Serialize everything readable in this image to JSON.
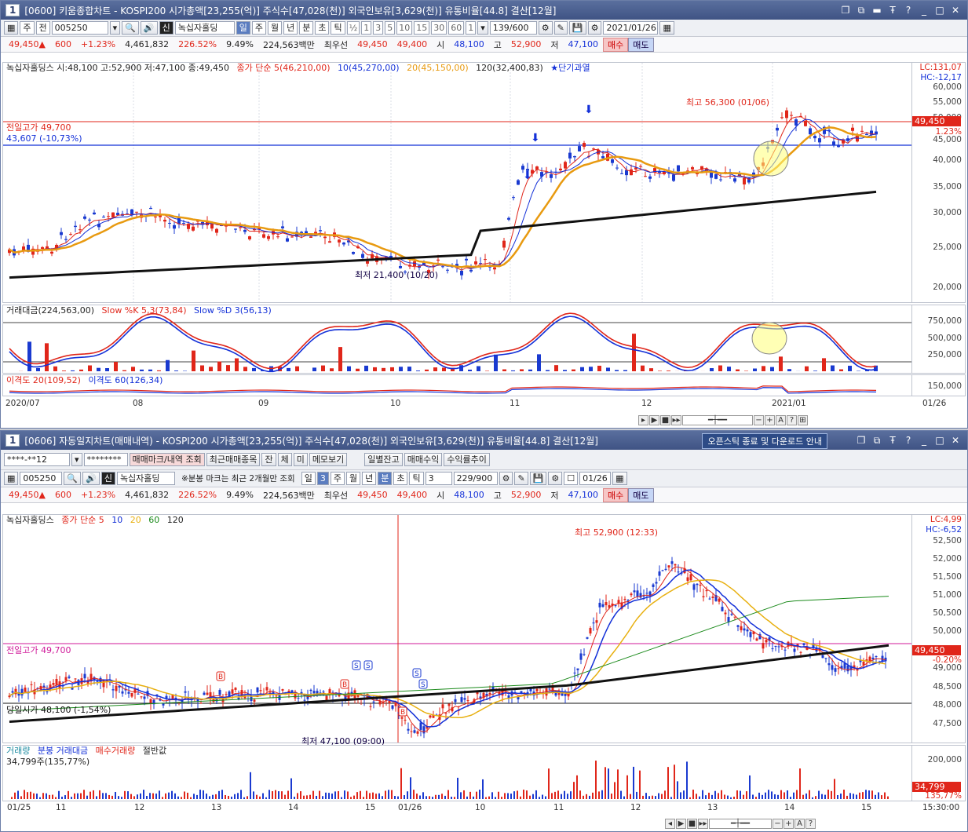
{
  "top": {
    "title": "[0600] 키움종합차트 - KOSPI200 시가총액[23,255(억)] 주식수[47,028(천)] 외국인보유[3,629(천)] 유통비율[44.8] 결산[12월]",
    "win_num": "1",
    "toolbar": {
      "type1": "주",
      "type2": "전",
      "code": "005250",
      "name": "녹십자홀딩",
      "periods": [
        "일",
        "주",
        "월",
        "년",
        "분",
        "초",
        "틱"
      ],
      "nums": [
        "½",
        "1",
        "3",
        "5",
        "10",
        "15",
        "30",
        "60",
        "1"
      ],
      "count": "139/600",
      "date": "2021/01/26"
    },
    "price": {
      "cur": "49,450▲",
      "chg": "600",
      "pct": "+1.23%",
      "vol": "4,461,832",
      "volpct": "226.52%",
      "turn": "9.49%",
      "amt": "224,563백만",
      "pref_label": "최우선",
      "ask": "49,450",
      "bid": "49,400",
      "open_label": "시",
      "open": "48,100",
      "high_label": "고",
      "high": "52,900",
      "low_label": "저",
      "low": "47,100",
      "buy": "매수",
      "sell": "매도"
    },
    "legend": {
      "stock": "녹십자홀딩스 시:48,100 고:52,900 저:47,100 종:49,450",
      "ma": "종가 단순 5(46,210,00)",
      "ma10": "10(45,270,00)",
      "ma20": "20(45,150,00)",
      "ma120": "120(32,400,83)",
      "star": "★단기과열"
    },
    "lc": "LC:131,07",
    "hc": "HC:-12,17",
    "y_ticks": [
      "60,000",
      "55,000",
      "50,000",
      "45,000",
      "40,000",
      "35,000",
      "30,000",
      "25,000",
      "20,000"
    ],
    "price_tag": "49,450",
    "price_pct": "1.23%",
    "prev_high": "전일고가 49,700",
    "hline2": "43,607 (-10,73%)",
    "max_ann": "최고 56,300 (01/06)",
    "min_ann": "최저 21,400 (10/20)",
    "ind_legend": {
      "a": "거래대금(224,563,00)",
      "b": "Slow %K 5,3(73,84)",
      "c": "Slow %D 3(56,13)"
    },
    "ind_ticks": [
      "750,000",
      "500,000",
      "250,000"
    ],
    "disp_legend": {
      "a": "이격도 20(109,52)",
      "b": "이격도 60(126,34)"
    },
    "disp_tick": "150,000",
    "x_labels": [
      "2020/07",
      "08",
      "09",
      "10",
      "11",
      "12",
      "2021/01"
    ],
    "x_right": "01/26"
  },
  "bottom": {
    "title": "[0606] 자동일지차트(매매내역) - KOSPI200 시가총액[23,255(억)] 주식수[47,028(천)] 외국인보유[3,629(천)] 유통비율[44.8] 결산[12월]",
    "win_num": "1",
    "notice": "오픈스틱 종료 및 다운로드 안내",
    "account": "****-**12",
    "password": "********",
    "btns": [
      "매매마크/내역 조회",
      "최근매매종목",
      "잔",
      "체",
      "미",
      "메모보기",
      "일별잔고",
      "매매수익",
      "수익률추이"
    ],
    "toolbar": {
      "code": "005250",
      "name": "녹십자홀딩",
      "note": "※분봉 마크는 최근 2개월만 조회",
      "periods": [
        "일",
        "3",
        "주",
        "월",
        "년",
        "분",
        "초",
        "틱"
      ],
      "tick": "3",
      "count": "229/900",
      "date": "01/26"
    },
    "price": {
      "cur": "49,450▲",
      "chg": "600",
      "pct": "+1.23%",
      "vol": "4,461,832",
      "volpct": "226.52%",
      "turn": "9.49%",
      "amt": "224,563백만",
      "pref_label": "최우선",
      "ask": "49,450",
      "bid": "49,400",
      "open_label": "시",
      "open": "48,100",
      "high_label": "고",
      "high": "52,900",
      "low_label": "저",
      "low": "47,100",
      "buy": "매수",
      "sell": "매도"
    },
    "legend": {
      "stock": "녹십자홀딩스",
      "ma": "종가 단순 5",
      "m10": "10",
      "m20": "20",
      "m60": "60",
      "m120": "120"
    },
    "lc": "LC:4,99",
    "hc": "HC:-6,52",
    "y_ticks": [
      "52,500",
      "52,000",
      "51,500",
      "51,000",
      "50,500",
      "50,000",
      "49,500",
      "49,000",
      "48,500",
      "48,000",
      "47,500"
    ],
    "price_tag": "49,450",
    "price_pct": "-0.20%",
    "prev_high": "전일고가 49,700",
    "open_line": "당일시가 48,100 (-1,54%)",
    "max_ann": "최고 52,900 (12:33)",
    "min_ann": "최저 47,100 (09:00)",
    "vol_legend": {
      "a": "거래량",
      "b": "분봉 거래대금",
      "c": "매수거래량",
      "d": "절반값"
    },
    "vol_sub": "34,799주(135,77%)",
    "vol_ticks": [
      "200,000",
      "100,000"
    ],
    "vol_tag": "34,799",
    "vol_tag2": "135,77%",
    "x_labels": [
      "01/25",
      "11",
      "12",
      "13",
      "14",
      "15",
      "01/26",
      "10",
      "11",
      "12",
      "13",
      "14",
      "15"
    ],
    "x_right": "15:30:00"
  }
}
